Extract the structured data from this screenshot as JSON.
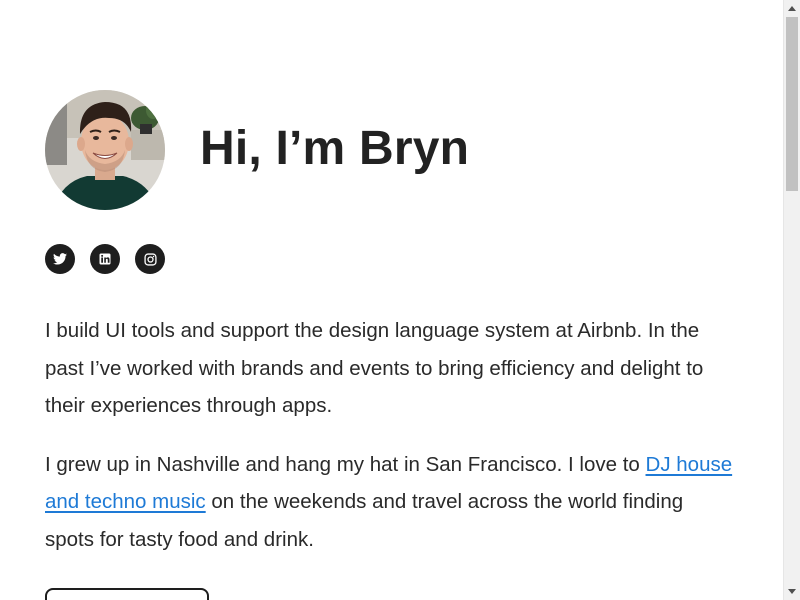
{
  "profile": {
    "title": "Hi, I’m Bryn",
    "avatar_icon": "portrait-photo"
  },
  "socials": [
    {
      "name": "Twitter",
      "icon": "twitter-icon"
    },
    {
      "name": "LinkedIn",
      "icon": "linkedin-icon"
    },
    {
      "name": "Instagram",
      "icon": "instagram-icon"
    }
  ],
  "bio": {
    "paragraph1": "I build UI tools and support the design language system at Airbnb. In the past I’ve worked with brands and events to bring efficiency and delight to their experiences through apps.",
    "paragraph2_before": "I grew up in Nashville and hang my hat in San Francisco. I love to ",
    "paragraph2_link": "DJ house and techno music",
    "paragraph2_after": " on the weekends and travel across the world finding spots for tasty food and drink."
  },
  "colors": {
    "text": "#222222",
    "link": "#1e7ad6",
    "icon_background": "#1e1e1e"
  }
}
